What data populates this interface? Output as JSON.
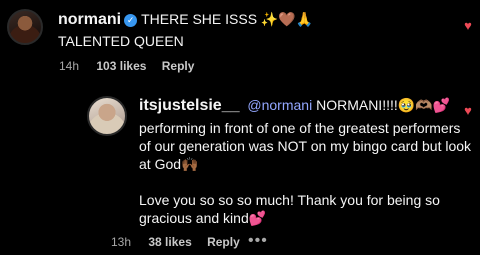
{
  "comment": {
    "username": "normani",
    "text_line1": "THERE SHE ISSS ✨🤎🙏",
    "text_line2": "TALENTED QUEEN",
    "time": "14h",
    "likes": "103 likes",
    "reply": "Reply",
    "heart_icon": "heart-icon",
    "like_color": "#ed4956"
  },
  "reply_comment": {
    "username": "itsjustelsie__",
    "mention": "@normani",
    "line1_rest": "NORMANI!!!!🥹🫶🏽💕",
    "line2": "performing in front of one of the greatest performers",
    "line3": "of our generation was NOT on my bingo card but look",
    "line4": "at God🙌🏾",
    "line5": "Love you so so so much! Thank you for being so",
    "line6": "gracious and kind💕",
    "time": "13h",
    "likes": "38 likes",
    "reply": "Reply",
    "more": "•••"
  },
  "colors": {
    "background": "#000000",
    "mention": "#93a7ff",
    "verified": "#3897f0"
  }
}
